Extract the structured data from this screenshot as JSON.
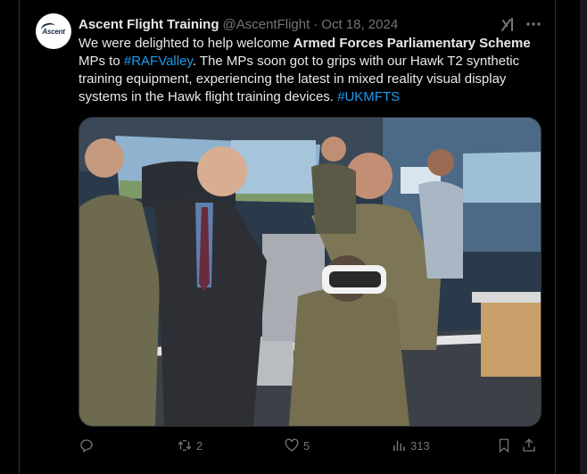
{
  "tweet": {
    "display_name": "Ascent Flight Training",
    "handle": "@AscentFlight",
    "separator": "·",
    "date": "Oct 18, 2024",
    "avatar_text": "Ascent",
    "body": {
      "t1": "We were delighted to help welcome ",
      "bold": "Armed Forces Parliamentary Scheme",
      "t2": " MPs to ",
      "hashtag1": "#RAFValley",
      "t3": ". The MPs soon got to grips with our Hawk T2 synthetic training equipment, experiencing the latest in mixed reality visual display systems in the Hawk flight training devices. ",
      "hashtag2": "#UKMFTS"
    },
    "media": {
      "icon": "photo-image"
    },
    "actions": {
      "reply": {
        "icon": "reply-icon",
        "count": ""
      },
      "retweet": {
        "icon": "retweet-icon",
        "count": "2"
      },
      "like": {
        "icon": "heart-icon",
        "count": "5"
      },
      "views": {
        "icon": "views-icon",
        "count": "313"
      },
      "bookmark": {
        "icon": "bookmark-icon"
      },
      "share": {
        "icon": "share-icon"
      }
    }
  },
  "colors": {
    "background": "#000000",
    "text": "#e7e9ea",
    "muted": "#71767b",
    "link": "#1d9bf0",
    "border": "#2f3336"
  }
}
